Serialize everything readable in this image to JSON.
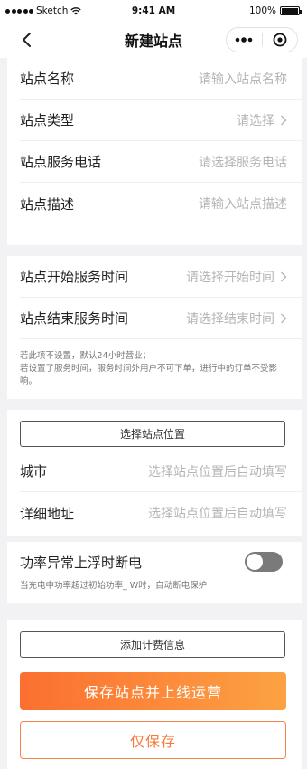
{
  "status_bar": {
    "carrier": "Sketch",
    "time": "9:41 AM",
    "battery": "100%"
  },
  "nav": {
    "title": "新建站点"
  },
  "basic_info": {
    "rows": [
      {
        "label": "站点名称",
        "value": "请输入站点名称",
        "has_arrow": false
      },
      {
        "label": "站点类型",
        "value": "请选择",
        "has_arrow": true
      },
      {
        "label": "站点服务电话",
        "value": "请选择服务电话",
        "has_arrow": false
      },
      {
        "label": "站点描述",
        "value": "请输入站点描述",
        "has_arrow": false
      }
    ]
  },
  "service_time": {
    "rows": [
      {
        "label": "站点开始服务时间",
        "value": "请选择开始时间",
        "has_arrow": true
      },
      {
        "label": "站点结束服务时间",
        "value": "请选择结束时间",
        "has_arrow": true
      }
    ],
    "hint_line1": "若此项不设置，默认24小时营业；",
    "hint_line2": "若设置了服务时间，服务时间外用户不可下单，进行中的订单不受影响。"
  },
  "location": {
    "select_button": "选择站点位置",
    "rows": [
      {
        "label": "城市",
        "value": "选择站点位置后自动填写"
      },
      {
        "label": "详细地址",
        "value": "选择站点位置后自动填写"
      }
    ]
  },
  "power": {
    "label": "功率异常上浮时断电",
    "toggle_on": false,
    "hint": "当充电中功率超过初始功率_ W时，自动断电保护"
  },
  "actions": {
    "add_billing": "添加计费信息",
    "save_and_publish": "保存站点并上线运营",
    "save_only": "仅保存"
  },
  "colors": {
    "accent_start": "#fb6f30",
    "accent_end": "#fca243",
    "placeholder": "#b5b5b5"
  }
}
